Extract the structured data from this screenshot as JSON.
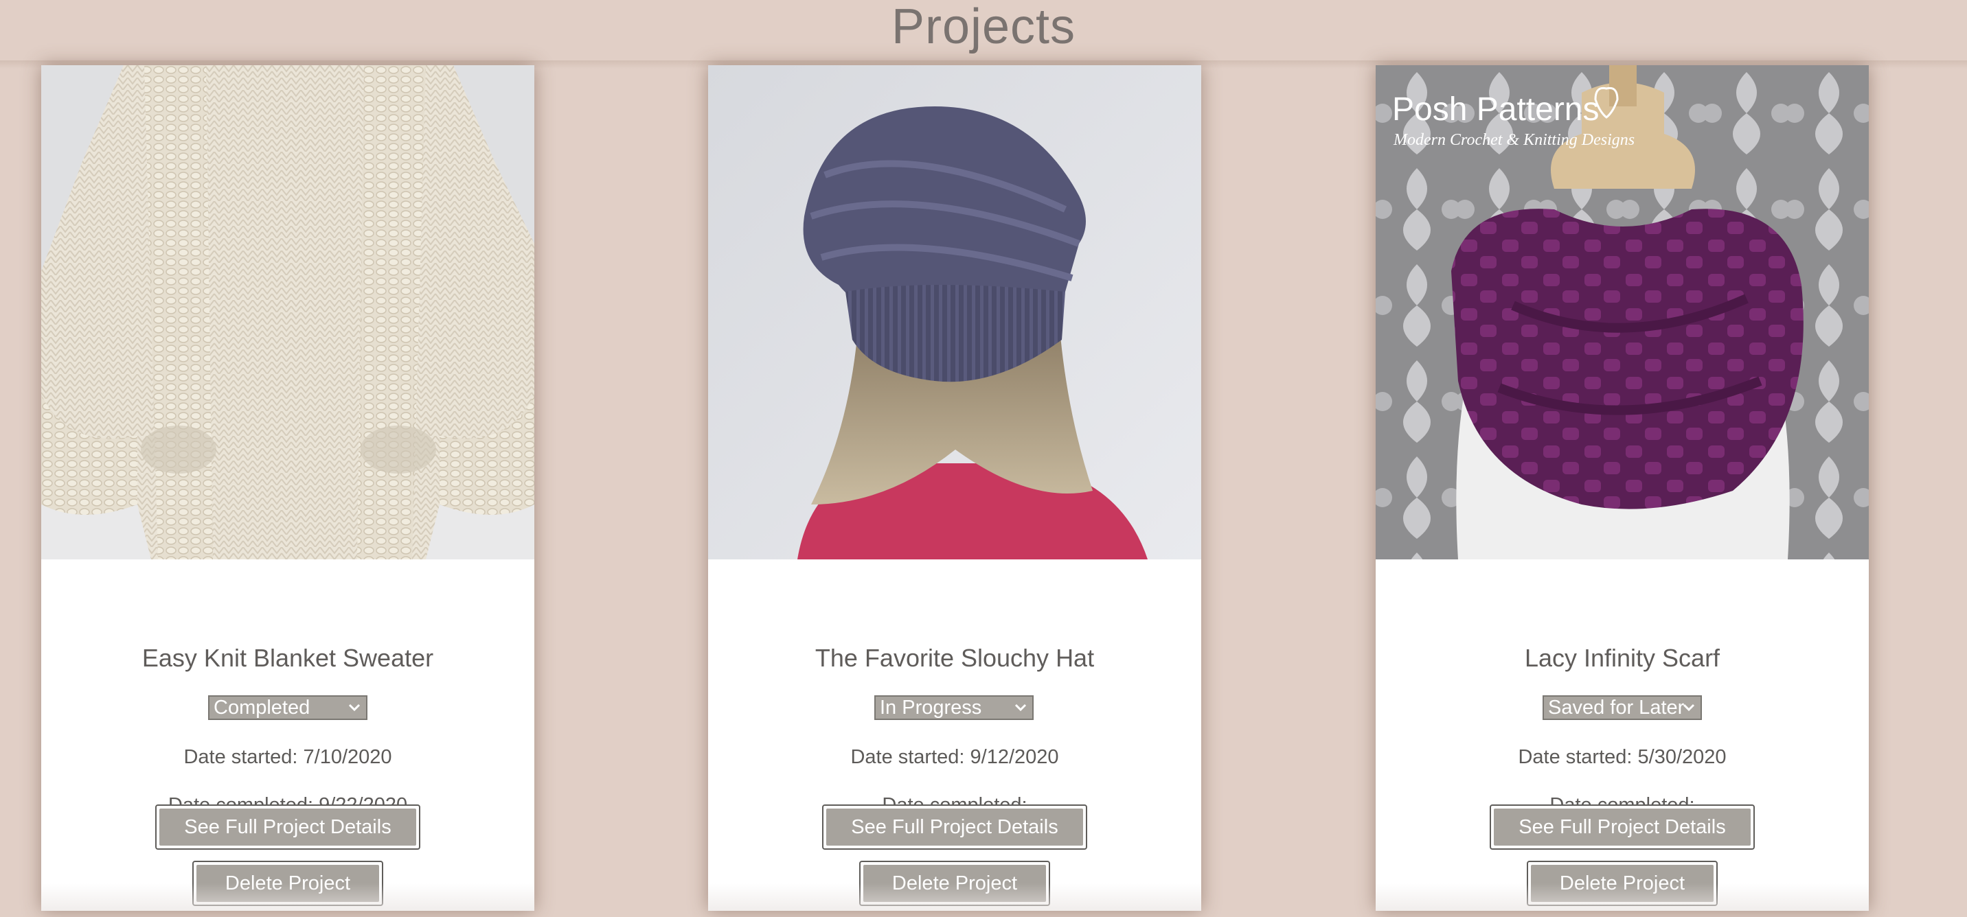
{
  "page": {
    "title": "Projects"
  },
  "colors": {
    "background": "#e1cfc6",
    "card": "#ffffff",
    "button": "#a7a39d",
    "title_text": "#7a7370"
  },
  "projects": [
    {
      "name": "Easy Knit Blanket Sweater",
      "image": "cream-knit-cardigan-photo",
      "status": "Completed",
      "date_started": "Date started: 7/10/2020",
      "date_completed": "Date completed: 9/22/2020",
      "details_label": "See Full Project Details",
      "delete_label": "Delete Project"
    },
    {
      "name": "The Favorite Slouchy Hat",
      "image": "purple-slouchy-beanie-photo",
      "status": "In Progress",
      "date_started": "Date started: 9/12/2020",
      "date_completed": "Date completed:",
      "details_label": "See Full Project Details",
      "delete_label": "Delete Project"
    },
    {
      "name": "Lacy Infinity Scarf",
      "image": "purple-infinity-scarf-photo",
      "image_logo": {
        "line1": "Posh Patterns",
        "line2": "Modern Crochet & Knitting Designs"
      },
      "status": "Saved for Later",
      "date_started": "Date started: 5/30/2020",
      "date_completed": "Date completed:",
      "details_label": "See Full Project Details",
      "delete_label": "Delete Project"
    }
  ]
}
